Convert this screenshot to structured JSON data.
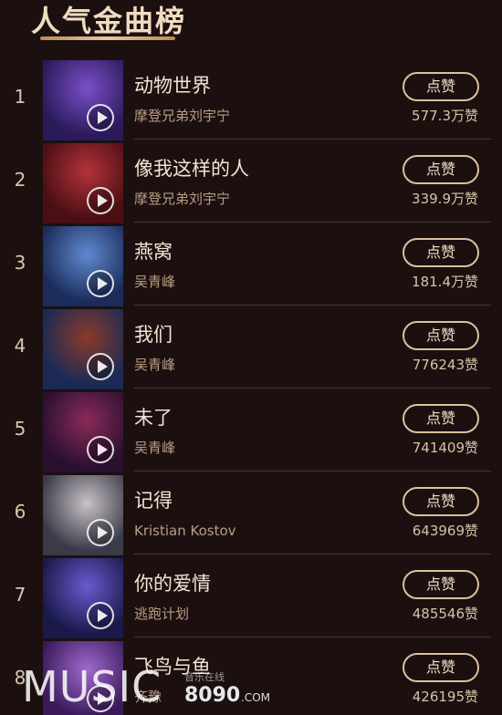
{
  "header": {
    "title": "人气金曲榜"
  },
  "songs": [
    {
      "rank": "1",
      "title": "动物世界",
      "artist": "摩登兄弟刘宇宁",
      "button": "点赞",
      "likes": "577.3万赞",
      "c1": "#2a1a5a",
      "c2": "#7a4fc8"
    },
    {
      "rank": "2",
      "title": "像我这样的人",
      "artist": "摩登兄弟刘宇宁",
      "button": "点赞",
      "likes": "339.9万赞",
      "c1": "#4a0f14",
      "c2": "#b4323a"
    },
    {
      "rank": "3",
      "title": "燕窝",
      "artist": "吴青峰",
      "button": "点赞",
      "likes": "181.4万赞",
      "c1": "#1b2c5a",
      "c2": "#5f8ad0"
    },
    {
      "rank": "4",
      "title": "我们",
      "artist": "吴青峰",
      "button": "点赞",
      "likes": "776243赞",
      "c1": "#1a2a55",
      "c2": "#8a3a2a"
    },
    {
      "rank": "5",
      "title": "未了",
      "artist": "吴青峰",
      "button": "点赞",
      "likes": "741409赞",
      "c1": "#2a1030",
      "c2": "#8a2a5a"
    },
    {
      "rank": "6",
      "title": "记得",
      "artist": "Kristian Kostov",
      "button": "点赞",
      "likes": "643969赞",
      "c1": "#3a3a48",
      "c2": "#c9c2c6"
    },
    {
      "rank": "7",
      "title": "你的爱情",
      "artist": "逃跑计划",
      "button": "点赞",
      "likes": "485546赞",
      "c1": "#1a1a4a",
      "c2": "#6a5acf"
    },
    {
      "rank": "8",
      "title": "飞鸟与鱼",
      "artist": "齐豫",
      "button": "点赞",
      "likes": "426195赞",
      "c1": "#3a1a5a",
      "c2": "#a06ad0"
    }
  ],
  "watermark": {
    "music": "MUSIC",
    "cn": "音乐在线",
    "num": "8090",
    "com": ".COM"
  }
}
